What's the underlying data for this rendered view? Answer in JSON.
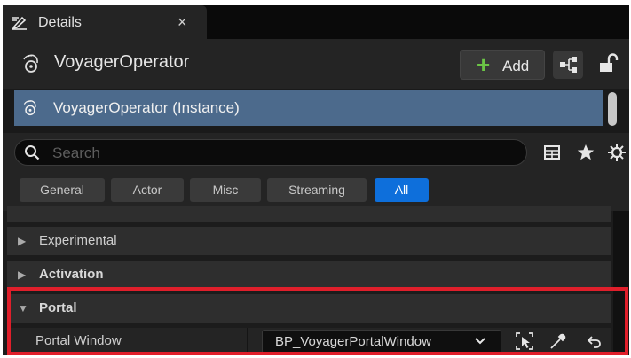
{
  "tab": {
    "title": "Details",
    "close": "×"
  },
  "header": {
    "actor_name": "VoyagerOperator",
    "add_label": "Add",
    "add_symbol": "+"
  },
  "tree": {
    "selected": "VoyagerOperator (Instance)"
  },
  "search": {
    "placeholder": "Search",
    "value": ""
  },
  "filters": [
    {
      "label": "General",
      "active": false
    },
    {
      "label": "Actor",
      "active": false
    },
    {
      "label": "Misc",
      "active": false
    },
    {
      "label": "Streaming",
      "active": false
    },
    {
      "label": "All",
      "active": true
    }
  ],
  "categories": [
    {
      "label": "Experimental",
      "expanded": false
    },
    {
      "label": "Activation",
      "expanded": false
    },
    {
      "label": "Portal",
      "expanded": true
    }
  ],
  "property": {
    "label": "Portal Window",
    "value": "BP_VoyagerPortalWindow"
  },
  "colors": {
    "accent": "#0e6fdb",
    "selection": "#4c6a8c",
    "add_plus": "#6bc446",
    "highlight": "#e01f2b"
  }
}
